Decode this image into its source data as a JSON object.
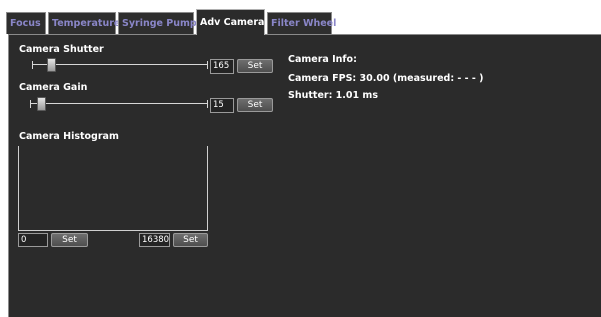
{
  "tabs": [
    {
      "label": "Focus",
      "active": false
    },
    {
      "label": "Temperature",
      "active": false
    },
    {
      "label": "Syringe Pump",
      "active": false
    },
    {
      "label": "Adv Camera",
      "active": true
    },
    {
      "label": "Filter Wheel",
      "active": false
    }
  ],
  "shutter": {
    "label": "Camera Shutter",
    "value": "165",
    "set_label": "Set",
    "slider_fraction": 0.09
  },
  "gain": {
    "label": "Camera Gain",
    "value": "15",
    "set_label": "Set",
    "slider_fraction": 0.04
  },
  "histogram": {
    "label": "Camera Histogram",
    "min_value": "0",
    "min_set_label": "Set",
    "max_value": "16380",
    "max_set_label": "Set"
  },
  "info": {
    "title": "Camera Info:",
    "fps_line": "Camera FPS: 30.00 (measured:  - - - )",
    "shutter_line": "Shutter: 1.01 ms"
  },
  "colors": {
    "panel_bg": "#2b2b2b",
    "inactive_tab_text": "#8a86c8",
    "active_tab_text": "#ffffff"
  }
}
